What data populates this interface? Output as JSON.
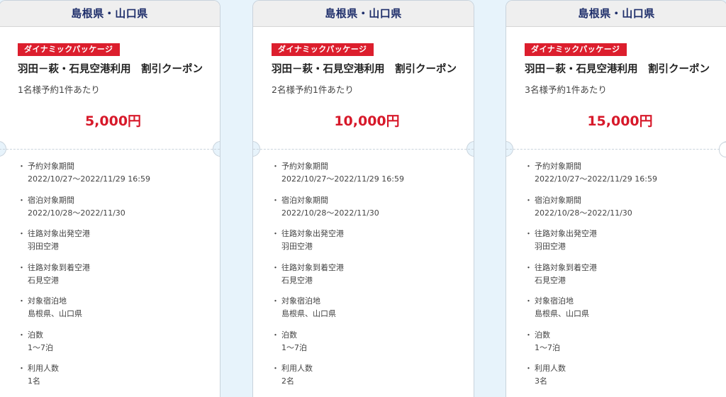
{
  "cards": [
    {
      "region": "島根県・山口県",
      "badge": "ダイナミックパッケージ",
      "title": "羽田－萩・石見空港利用　割引クーポン",
      "per": "1名様予約1件あたり",
      "price": "5,000円",
      "details": [
        {
          "label": "予約対象期間",
          "value": "2022/10/27～2022/11/29 16:59"
        },
        {
          "label": "宿泊対象期間",
          "value": "2022/10/28～2022/11/30"
        },
        {
          "label": "往路対象出発空港",
          "value": "羽田空港"
        },
        {
          "label": "往路対象到着空港",
          "value": "石見空港"
        },
        {
          "label": "対象宿泊地",
          "value": "島根県、山口県"
        },
        {
          "label": "泊数",
          "value": "1～7泊"
        },
        {
          "label": "利用人数",
          "value": "1名"
        }
      ]
    },
    {
      "region": "島根県・山口県",
      "badge": "ダイナミックパッケージ",
      "title": "羽田－萩・石見空港利用　割引クーポン",
      "per": "2名様予約1件あたり",
      "price": "10,000円",
      "details": [
        {
          "label": "予約対象期間",
          "value": "2022/10/27～2022/11/29 16:59"
        },
        {
          "label": "宿泊対象期間",
          "value": "2022/10/28～2022/11/30"
        },
        {
          "label": "往路対象出発空港",
          "value": "羽田空港"
        },
        {
          "label": "往路対象到着空港",
          "value": "石見空港"
        },
        {
          "label": "対象宿泊地",
          "value": "島根県、山口県"
        },
        {
          "label": "泊数",
          "value": "1～7泊"
        },
        {
          "label": "利用人数",
          "value": "2名"
        }
      ]
    },
    {
      "region": "島根県・山口県",
      "badge": "ダイナミックパッケージ",
      "title": "羽田－萩・石見空港利用　割引クーポン",
      "per": "3名様予約1件あたり",
      "price": "15,000円",
      "details": [
        {
          "label": "予約対象期間",
          "value": "2022/10/27～2022/11/29 16:59"
        },
        {
          "label": "宿泊対象期間",
          "value": "2022/10/28～2022/11/30"
        },
        {
          "label": "往路対象出発空港",
          "value": "羽田空港"
        },
        {
          "label": "往路対象到着空港",
          "value": "石見空港"
        },
        {
          "label": "対象宿泊地",
          "value": "島根県、山口県"
        },
        {
          "label": "泊数",
          "value": "1～7泊"
        },
        {
          "label": "利用人数",
          "value": "3名"
        }
      ]
    }
  ],
  "bullet": "・"
}
